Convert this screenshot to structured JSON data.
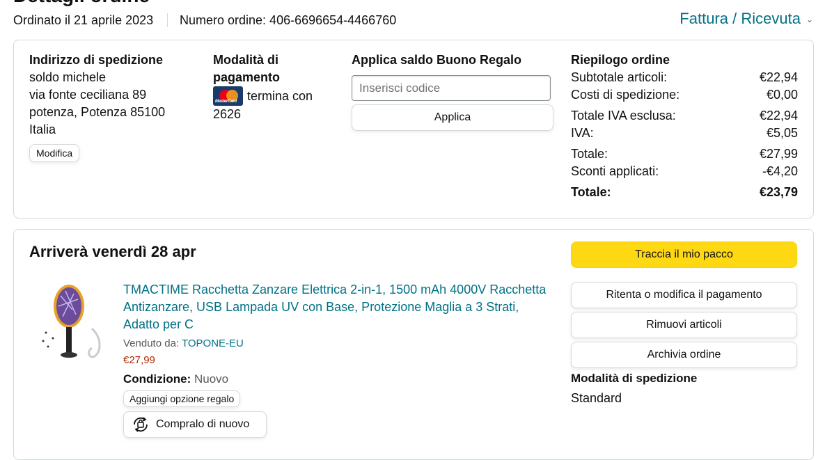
{
  "header": {
    "page_title": "Dettagli ordine",
    "ordered_on": "Ordinato il 21 aprile 2023",
    "order_number": "Numero ordine: 406-6696654-4466760",
    "invoice_label": "Fattura / Ricevuta"
  },
  "shipping_address": {
    "title": "Indirizzo di spedizione",
    "name": "soldo michele",
    "street": "via fonte ceciliana 89",
    "city": "potenza, Potenza 85100",
    "country": "Italia",
    "edit_label": "Modifica"
  },
  "payment": {
    "title_line1": "Modalità di",
    "title_line2": "pagamento",
    "card_brand": "MasterCard",
    "card_text": "termina con",
    "card_last4": "2626"
  },
  "gift_card": {
    "title": "Applica saldo Buono Regalo",
    "placeholder": "Inserisci codice",
    "apply_label": "Applica"
  },
  "summary": {
    "title": "Riepilogo ordine",
    "rows": [
      {
        "label": "Subtotale articoli:",
        "value": "€22,94"
      },
      {
        "label": "Costi di spedizione:",
        "value": "€0,00"
      },
      {
        "label": "Totale IVA esclusa:",
        "value": "€22,94"
      },
      {
        "label": "IVA:",
        "value": "€5,05"
      },
      {
        "label": "Totale:",
        "value": "€27,99"
      },
      {
        "label": "Sconti applicati:",
        "value": "-€4,20"
      },
      {
        "label": "Totale:",
        "value": "€23,79"
      }
    ]
  },
  "shipment": {
    "arrival": "Arriverà venerdì 28 apr",
    "product": {
      "title": "TMACTIME Racchetta Zanzare Elettrica 2-in-1, 1500 mAh 4000V Racchetta Antizanzare, USB Lampada UV con Base, Protezione Maglia a 3 Strati, Adatto per C",
      "sold_by_label": "Venduto da:",
      "seller": "TOPONE-EU",
      "price": "€27,99",
      "condition_label": "Condizione:",
      "condition_value": "Nuovo",
      "gift_option_label": "Aggiungi opzione regalo",
      "buy_again_label": "Compralo di nuovo"
    },
    "actions": {
      "track": "Traccia il mio pacco",
      "retry_payment": "Ritenta o modifica il pagamento",
      "remove_items": "Rimuovi articoli",
      "archive": "Archivia ordine"
    },
    "shipping_method_title": "Modalità di spedizione",
    "shipping_method_value": "Standard"
  },
  "colors": {
    "link": "#007185",
    "price": "#b12704",
    "primary_button": "#ffd814",
    "border": "#d5d9d9"
  }
}
